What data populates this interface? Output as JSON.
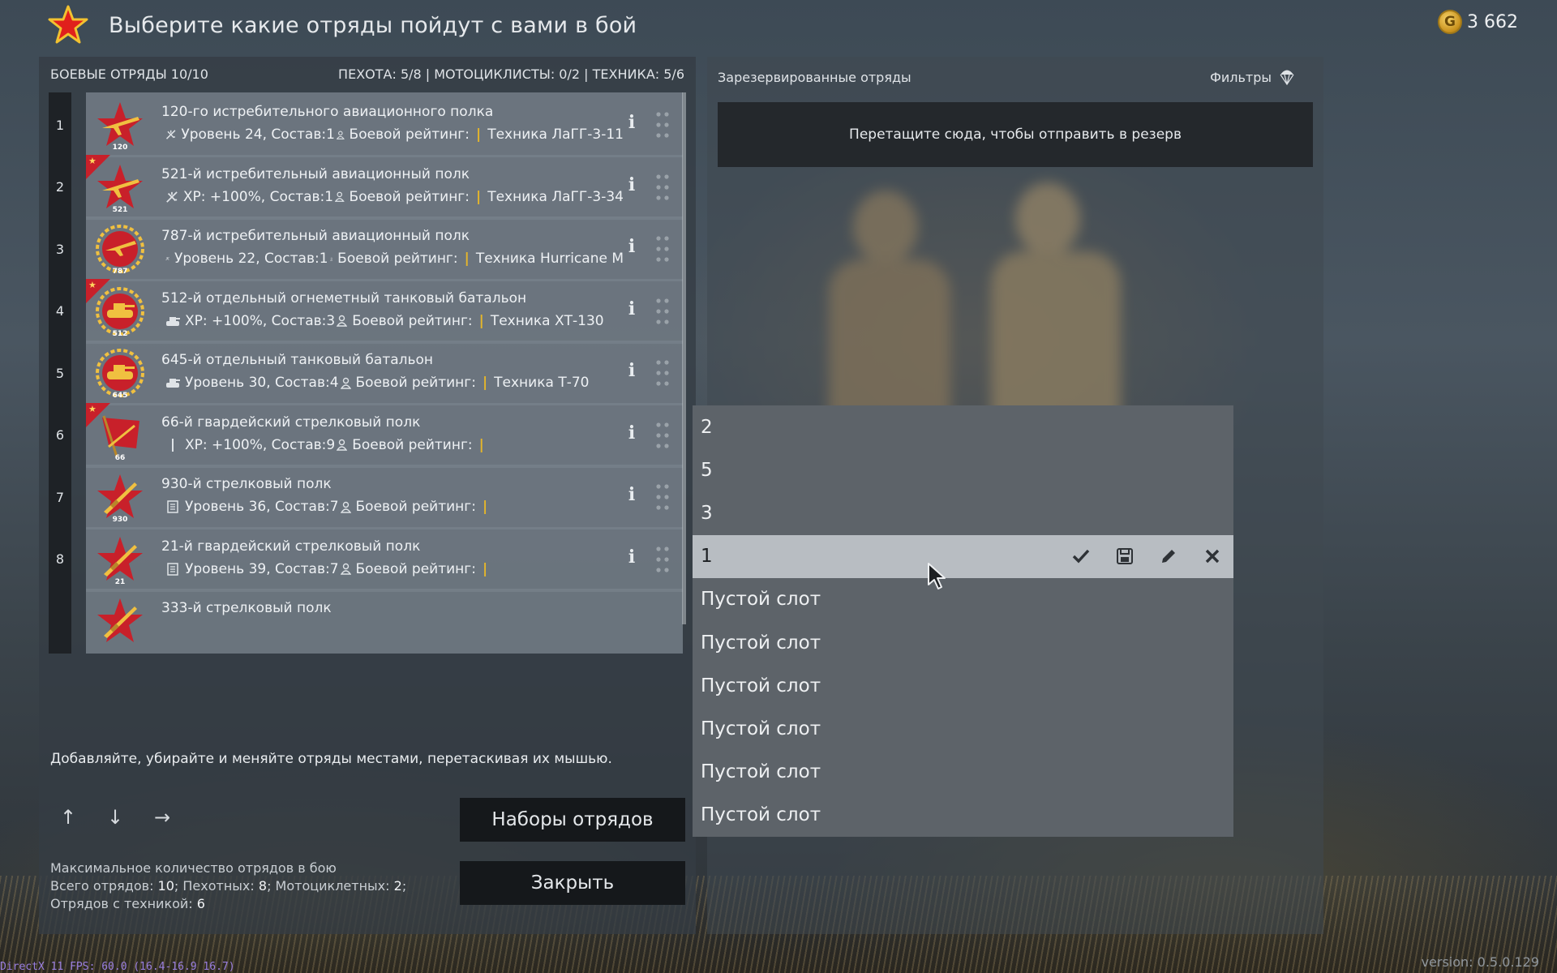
{
  "header": {
    "title": "Выберите какие отряды пойдут с вами в бой",
    "gold_symbol": "G",
    "gold_amount": "3 662"
  },
  "left": {
    "battle_squads": "БОЕВЫЕ ОТРЯДЫ 10/10",
    "counts": "ПЕХОТА: 5/8 | МОТОЦИКЛИСТЫ: 0/2 | ТЕХНИКА: 5/6",
    "squads": [
      {
        "num": "1",
        "name": "120-го истребительного авиационного полка",
        "emblem": "120",
        "emblem_type": "plane-star",
        "premium": false,
        "class_icon": "aircraft-icon",
        "level": "Уровень 24, Состав:1",
        "rating": "Боевой рейтинг:",
        "tech": "Техника ЛаГГ-3-11"
      },
      {
        "num": "2",
        "name": "521-й истребительный авиационный полк",
        "emblem": "521",
        "emblem_type": "plane-star",
        "premium": true,
        "class_icon": "aircraft-icon",
        "level": "XP: +100%, Состав:1",
        "rating": "Боевой рейтинг:",
        "tech": "Техника ЛаГГ-3-34"
      },
      {
        "num": "3",
        "name": "787-й истребительный авиационный полк",
        "emblem": "787",
        "emblem_type": "plane-round",
        "premium": false,
        "class_icon": "aircraft-icon",
        "level": "Уровень 22, Состав:1",
        "rating": "Боевой рейтинг:",
        "tech": "Техника Hurricane M"
      },
      {
        "num": "4",
        "name": "512-й отдельный огнеметный танковый батальон",
        "emblem": "512",
        "emblem_type": "tank-round",
        "premium": true,
        "class_icon": "tank-icon",
        "level": "XP: +100%, Состав:3",
        "rating": "Боевой рейтинг:",
        "tech": "Техника ХТ-130"
      },
      {
        "num": "5",
        "name": "645-й отдельный танковый батальон",
        "emblem": "645",
        "emblem_type": "tank-round",
        "premium": false,
        "class_icon": "tank-icon",
        "level": "Уровень 30, Состав:4",
        "rating": "Боевой рейтинг:",
        "tech": "Техника Т-70"
      },
      {
        "num": "6",
        "name": "66-й гвардейский стрелковый полк",
        "emblem": "66",
        "emblem_type": "flag",
        "premium": true,
        "class_icon": "rifle-icon",
        "level": "XP: +100%, Состав:9",
        "rating": "Боевой рейтинг:",
        "tech": ""
      },
      {
        "num": "7",
        "name": "930-й стрелковый полк",
        "emblem": "930",
        "emblem_type": "rifle-star",
        "premium": false,
        "class_icon": "infantry-list-icon",
        "level": "Уровень 36, Состав:7",
        "rating": "Боевой рейтинг:",
        "tech": ""
      },
      {
        "num": "8",
        "name": "21-й гвардейский стрелковый полк",
        "emblem": "21",
        "emblem_type": "rifle-star",
        "premium": false,
        "class_icon": "infantry-list-icon",
        "level": "Уровень 39, Состав:7",
        "rating": "Боевой рейтинг:",
        "tech": ""
      },
      {
        "num": "",
        "name": "333-й стрелковый полк",
        "emblem": "",
        "emblem_type": "rifle-star",
        "premium": false,
        "class_icon": "",
        "level": "",
        "rating": "",
        "tech": ""
      }
    ],
    "hint": "Добавляйте, убирайте и меняйте отряды местами, перетаскивая их мышью.",
    "arrow_up": "↑",
    "arrow_down": "↓",
    "arrow_right": "→",
    "sets_button": "Наборы отрядов",
    "close_button": "Закрыть",
    "stats": {
      "title": "Максимальное количество отрядов в бою",
      "total_label": "Всего отрядов: ",
      "total": "10",
      "infantry_label": "; Пехотных: ",
      "infantry": "8",
      "moto_label": "; Мотоциклетных: ",
      "moto": "2",
      "moto_end": ";",
      "tech_label": "Отрядов с техникой: ",
      "tech": "6"
    }
  },
  "right": {
    "title": "Зарезервированные отряды",
    "filters": "Фильтры",
    "dropzone": "Перетащите сюда, чтобы отправить в резерв"
  },
  "preset_menu": {
    "items": [
      "2",
      "5",
      "3",
      "1",
      "Пустой слот",
      "Пустой слот",
      "Пустой слот",
      "Пустой слот",
      "Пустой слот",
      "Пустой слот"
    ],
    "active_index": 3
  },
  "footer": {
    "debug": "DirectX 11 FPS: 60.0 (16.4-16.9 16.7)",
    "version": "version: 0.5.0.129"
  },
  "colors": {
    "accent_red": "#c8202a",
    "separator_gold": "#e6b62a",
    "emblem_gold": "#f0c040"
  }
}
